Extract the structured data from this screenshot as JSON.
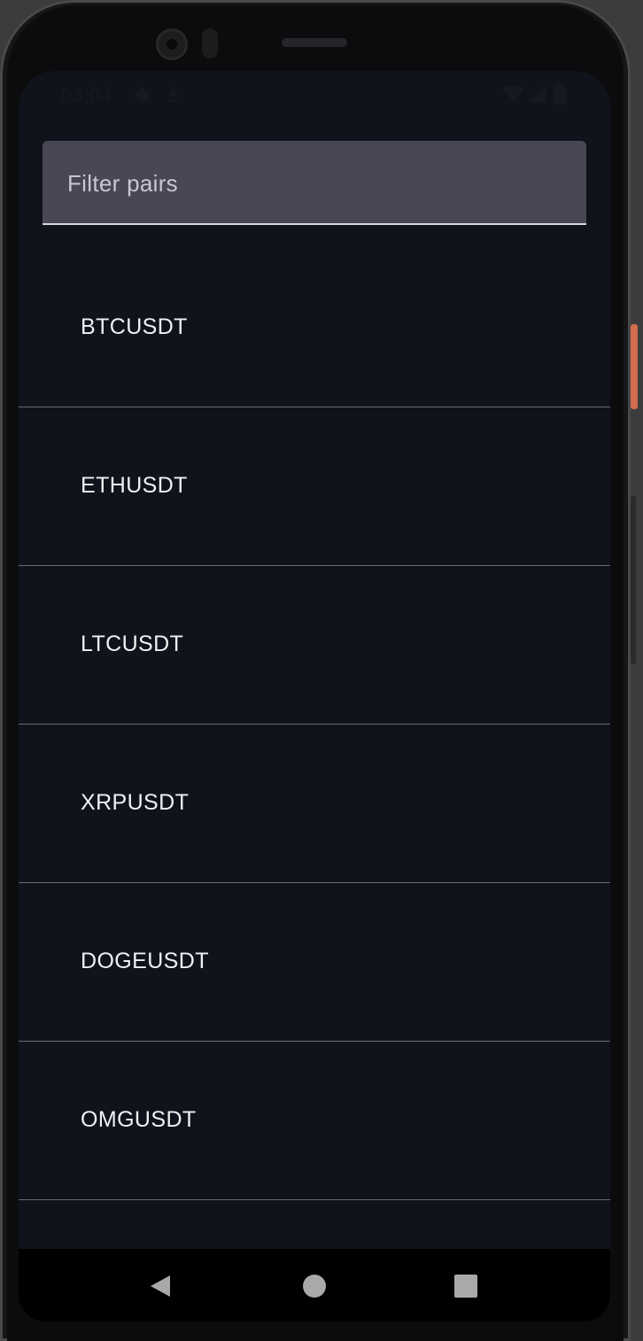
{
  "status_bar": {
    "time": "03:04",
    "icons": [
      "settings-icon",
      "download-icon",
      "wifi-icon",
      "signal-icon",
      "battery-icon"
    ]
  },
  "filter": {
    "placeholder": "Filter pairs",
    "value": ""
  },
  "pairs": [
    {
      "label": "BTCUSDT"
    },
    {
      "label": "ETHUSDT"
    },
    {
      "label": "LTCUSDT"
    },
    {
      "label": "XRPUSDT"
    },
    {
      "label": "DOGEUSDT"
    },
    {
      "label": "OMGUSDT"
    }
  ],
  "nav_bar": {
    "buttons": [
      "back-icon",
      "home-icon",
      "recents-icon"
    ]
  },
  "colors": {
    "screen_background": "#10131b",
    "filter_background": "#4a4754",
    "divider": "#6a6b70",
    "text": "#f0f0f3",
    "accent_side_button": "#d36d4d"
  }
}
